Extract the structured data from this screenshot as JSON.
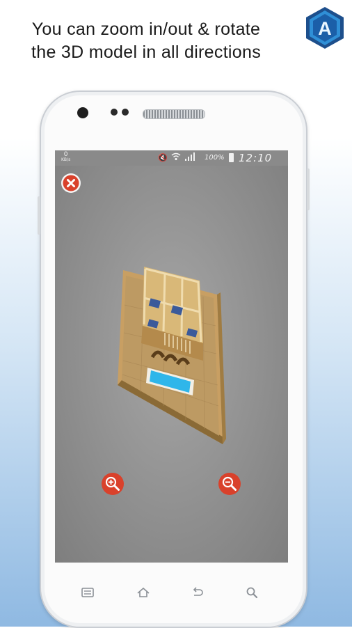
{
  "promo": {
    "caption_line1": "You can zoom in/out & rotate",
    "caption_line2": "the 3D model in all directions",
    "logo_letter": "A"
  },
  "statusbar": {
    "speed_value": "0",
    "speed_unit": "KB/s",
    "battery": "100%",
    "time": "12:10 PM",
    "icons": [
      "mute-icon",
      "wifi-icon",
      "signal-icon",
      "battery-icon"
    ]
  },
  "viewer": {
    "close_icon": "close-icon",
    "zoom_in_icon": "zoom-in-icon",
    "zoom_out_icon": "zoom-out-icon",
    "button_color": "#d9412b",
    "model": "3d-house-model"
  },
  "navbar": {
    "keys": [
      "menu-icon",
      "home-icon",
      "back-icon",
      "search-icon"
    ]
  }
}
